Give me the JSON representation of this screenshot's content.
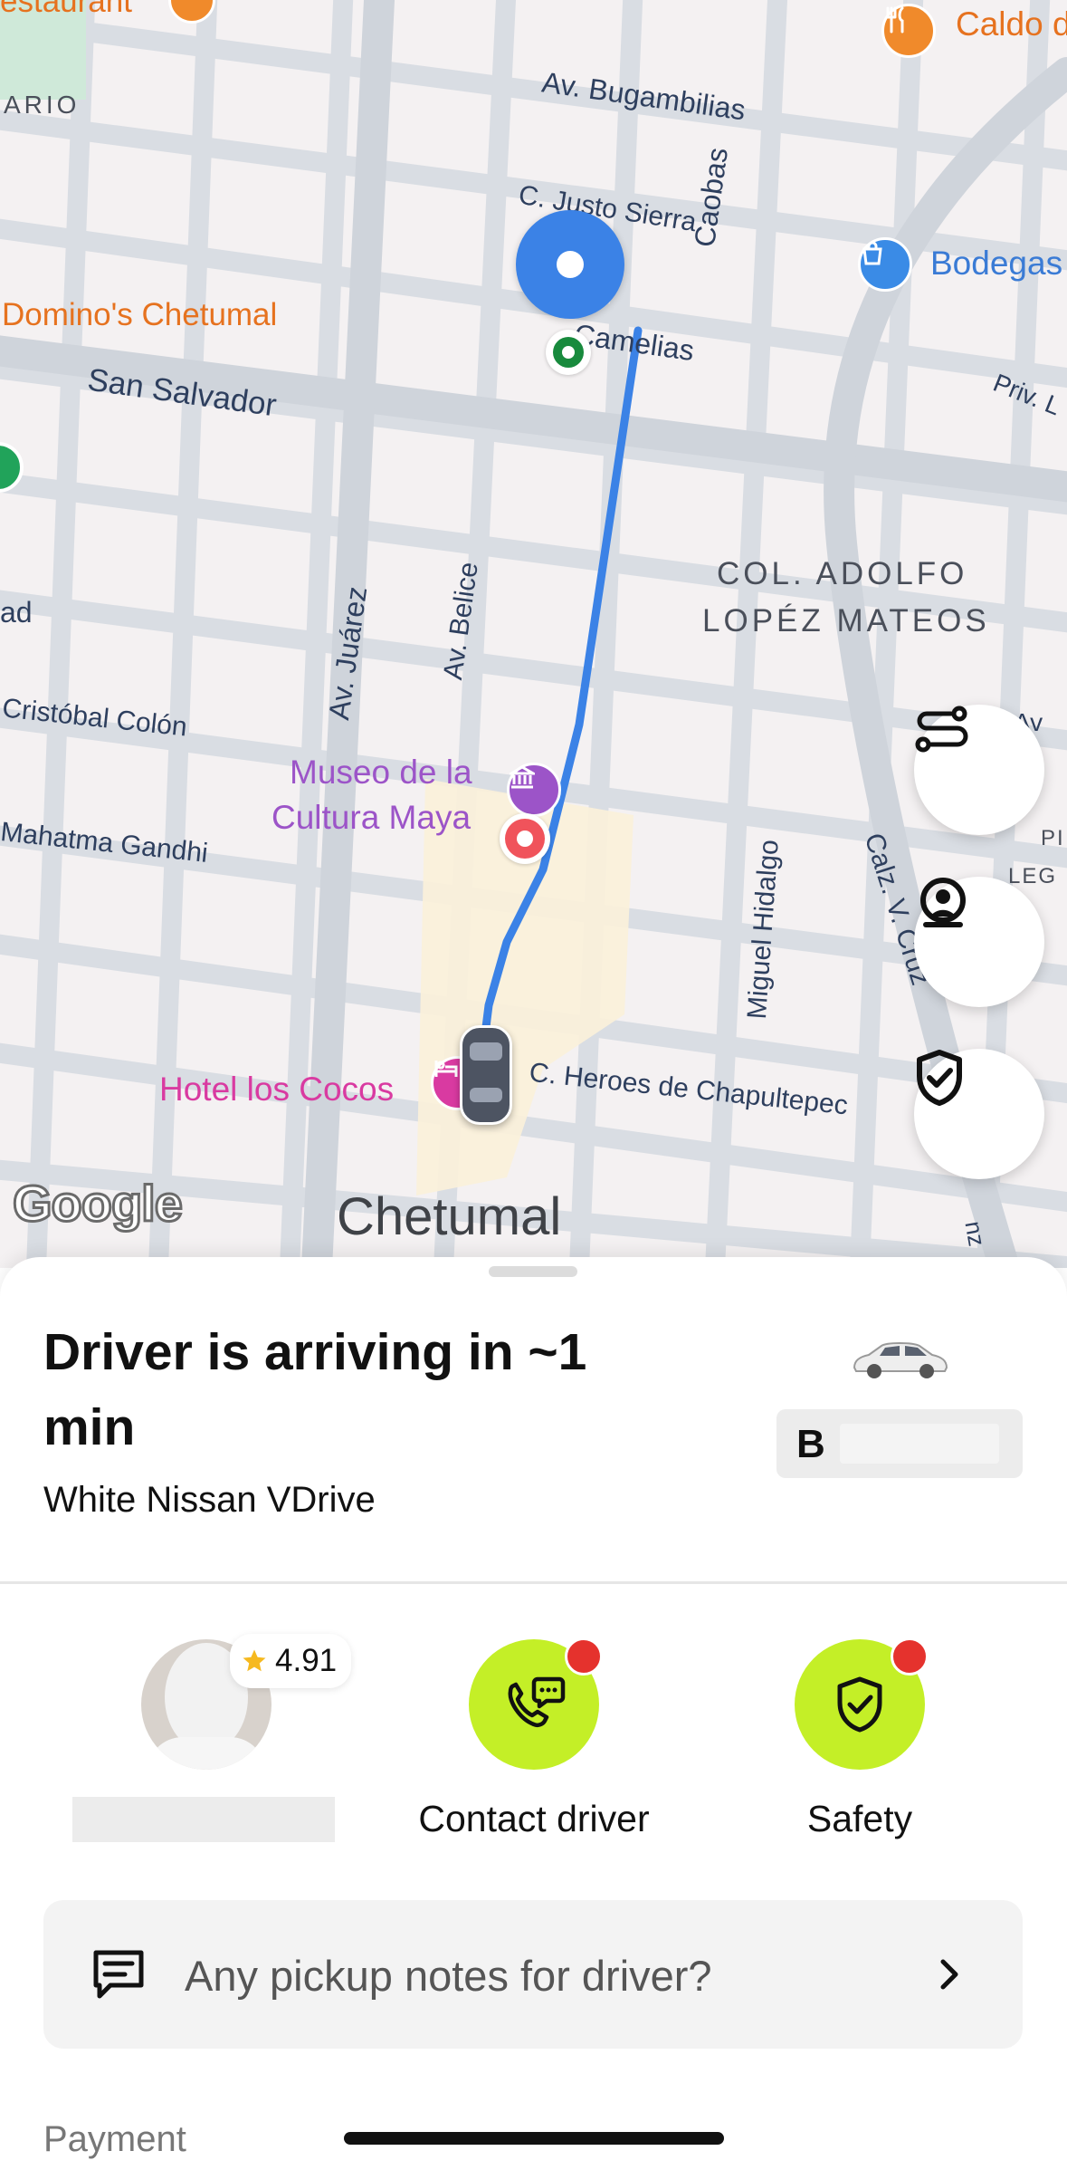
{
  "map": {
    "streets": {
      "bugambilias": "Av. Bugambilias",
      "justo_sierra": "C. Justo Sierra",
      "caobas": "Caobas",
      "camelias": "Camelias",
      "san_salvador": "San Salvador",
      "juarez": "Av. Juárez",
      "belice": "Av. Belice",
      "cristobal_colon": "Cristóbal Colón",
      "mahatma_gandhi": "Mahatma Gandhi",
      "miguel_hidalgo": "Miguel Hidalgo",
      "heroes": "C. Heroes de Chapultepec",
      "calz": "Calz. V. Cruz",
      "priv": "Priv. L",
      "ad_fragment": "ad",
      "ario_fragment": "ARIO",
      "av_fragment": "Av",
      "p_fragment": "PI",
      "leg_fragment": "LEG",
      "nz_fragment": "nz"
    },
    "pois": {
      "restaurant": "estaurant",
      "caldo": "Caldo d",
      "bodegas": "Bodegas",
      "dominos": "Domino's Chetumal",
      "museo_line1": "Museo de la",
      "museo_line2": "Cultura Maya",
      "hotel": "Hotel los Cocos"
    },
    "district_line1": "COL. ADOLFO",
    "district_line2": "LOPÉZ MATEOS",
    "city": "Chetumal",
    "logo": "Google",
    "icons": {
      "route_button": "route-icon",
      "share_button": "live-location-icon",
      "safety_button": "shield-check-icon"
    }
  },
  "trip": {
    "title": "Driver is arriving in ~1 min",
    "vehicle": "White Nissan VDrive",
    "plate_prefix": "B"
  },
  "driver": {
    "rating": "4.91",
    "contact_label": "Contact driver",
    "safety_label": "Safety"
  },
  "notes": {
    "placeholder": "Any pickup notes for driver?"
  },
  "payment_label": "Payment",
  "colors": {
    "accent": "#c4ef27",
    "route": "#3b82e6",
    "badge": "#e5322d"
  }
}
